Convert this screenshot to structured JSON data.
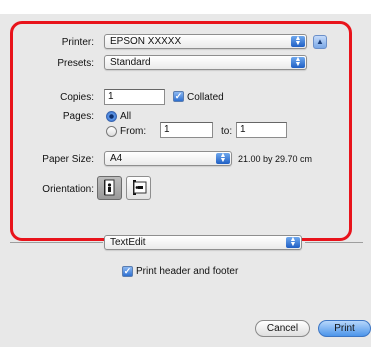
{
  "printer": {
    "label": "Printer:",
    "value": "EPSON XXXXX"
  },
  "presets": {
    "label": "Presets:",
    "value": "Standard"
  },
  "copies": {
    "label": "Copies:",
    "value": "1",
    "collated_label": "Collated"
  },
  "pages": {
    "label": "Pages:",
    "all_label": "All",
    "from_label": "From:",
    "from_value": "1",
    "to_label": "to:",
    "to_value": "1"
  },
  "paper_size": {
    "label": "Paper Size:",
    "value": "A4",
    "dimensions": "21.00 by 29.70 cm"
  },
  "orientation": {
    "label": "Orientation:"
  },
  "section_popup": {
    "value": "TextEdit"
  },
  "header_footer": {
    "label": "Print header and footer"
  },
  "buttons": {
    "cancel": "Cancel",
    "print": "Print"
  },
  "colors": {
    "highlight": "#e8131b",
    "accent": "#2d6fd0"
  }
}
